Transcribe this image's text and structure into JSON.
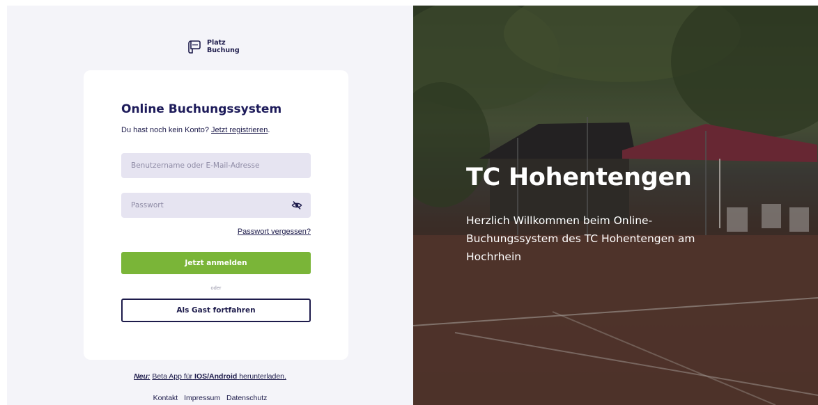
{
  "brand": {
    "line1": "Platz",
    "line2": "Buchung",
    "icon": "court-logo-icon"
  },
  "login": {
    "title": "Online Buchungssystem",
    "no_account_text": "Du hast noch kein Konto?",
    "register_link": "Jetzt registrieren",
    "register_suffix": ".",
    "username_placeholder": "Benutzername oder E-Mail-Adresse",
    "password_placeholder": "Passwort",
    "toggle_password_icon": "eye-off-icon",
    "forgot_link": "Passwort vergessen?",
    "login_button": "Jetzt anmelden",
    "or_text": "oder",
    "guest_button": "Als Gast fortfahren"
  },
  "beta": {
    "prefix": "Neu:",
    "text1": "Beta App für",
    "platforms": "IOS/Android",
    "text2": "herunterladen."
  },
  "footer": {
    "links": [
      "Kontakt",
      "Impressum",
      "Datenschutz"
    ]
  },
  "hero": {
    "title": "TC Hohentengen",
    "text": "Herzlich Willkommen beim Online-Buchungssystem des TC Hohentengen am Hochrhein"
  },
  "colors": {
    "primary": "#1d1b4b",
    "accent": "#7ab538",
    "panel": "#f4f4f9",
    "input": "#e6e4f1"
  }
}
